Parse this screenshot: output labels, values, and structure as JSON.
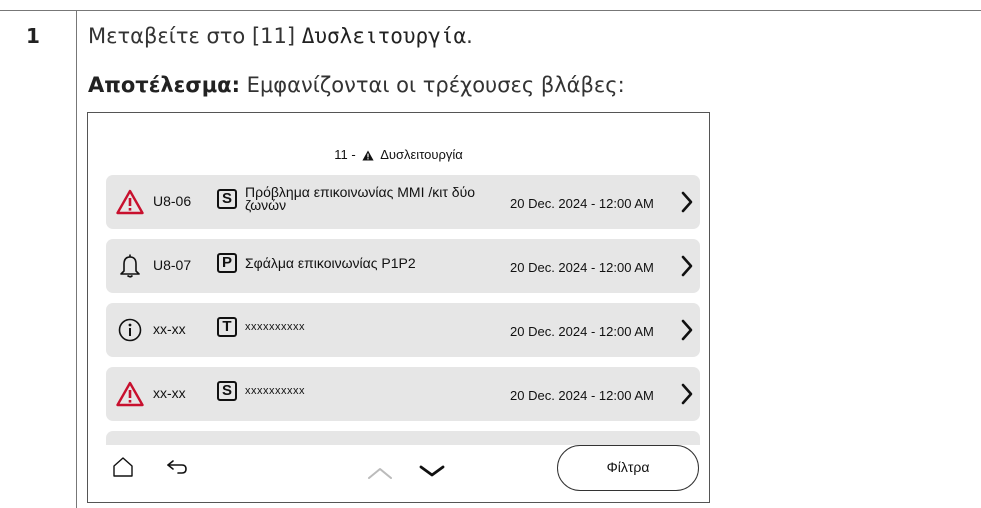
{
  "step": {
    "number": "1",
    "instruction_prefix": "Μεταβείτε στο [11] ",
    "instruction_menu": "Δυσλειτουργία",
    "instruction_suffix": ".",
    "result_label": "Αποτέλεσμα:",
    "result_text": " Εμφανίζονται οι τρέχουσες βλάβες:"
  },
  "screen": {
    "title_prefix": "11 -",
    "title_text": "Δυσλειτουργία",
    "rows": [
      {
        "icon": "warning-triangle-icon",
        "code": "U8-06",
        "source": "S",
        "description": "Πρόβλημα επικοινωνίας MMI /κιτ δύο ζωνών",
        "datetime": "20 Dec. 2024 - 12:00 AM"
      },
      {
        "icon": "bell-icon",
        "code": "U8-07",
        "source": "P",
        "description": "Σφάλμα επικοινωνίας P1P2",
        "datetime": "20 Dec. 2024 - 12:00 AM"
      },
      {
        "icon": "info-icon",
        "code": "xx-xx",
        "source": "T",
        "description": "xxxxxxxxxx",
        "datetime": "20 Dec. 2024 - 12:00 AM"
      },
      {
        "icon": "warning-triangle-icon",
        "code": "xx-xx",
        "source": "S",
        "description": "xxxxxxxxxx",
        "datetime": "20 Dec. 2024 - 12:00 AM"
      }
    ],
    "filter_label": "Φίλτρα"
  },
  "colors": {
    "error_red": "#c8102e",
    "row_bg": "#e6e6e6"
  }
}
